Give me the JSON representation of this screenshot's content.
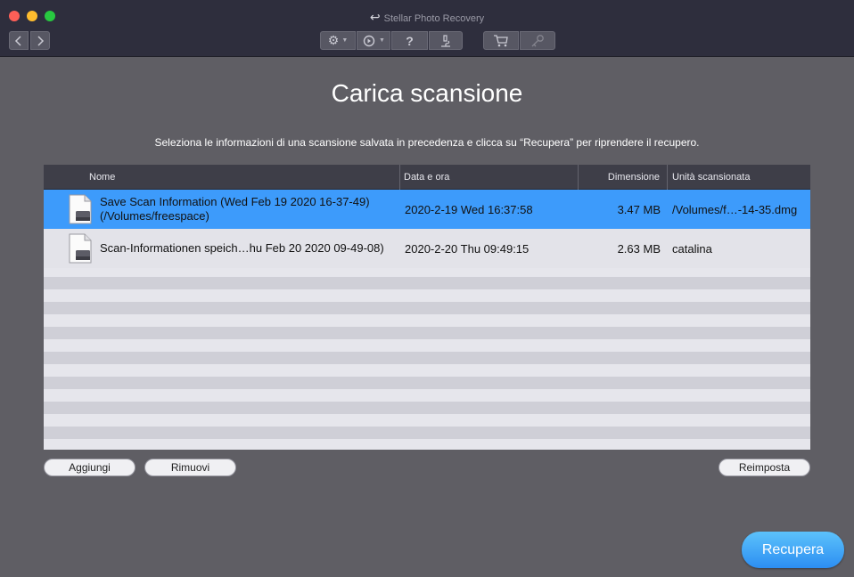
{
  "window": {
    "title": "Stellar Photo Recovery"
  },
  "toolbar": {
    "icons": {
      "back": "chevron-left-icon",
      "forward": "chevron-right-icon",
      "settings": "gear-icon",
      "history": "history-icon",
      "help": "question-icon",
      "scan": "microscope-icon",
      "cart": "cart-icon",
      "key": "key-icon"
    },
    "help_glyph": "?"
  },
  "page": {
    "title": "Carica scansione",
    "subtitle": "Seleziona le informazioni di una scansione salvata in precedenza e clicca su “Recupera” per riprendere il recupero."
  },
  "table": {
    "columns": {
      "name": "Nome",
      "date": "Data e ora",
      "size": "Dimensione",
      "unit": "Unità scansionata"
    },
    "rows": [
      {
        "name_line1": "Save Scan Information (Wed Feb 19 2020 16-37-49)",
        "name_line2": "(/Volumes/freespace)",
        "date": "2020-2-19 Wed 16:37:58",
        "size": "3.47 MB",
        "unit": "/Volumes/f…-14-35.dmg",
        "selected": true
      },
      {
        "name_line1": "Scan-Informationen speich…hu Feb 20 2020 09-49-08)",
        "date": "2020-2-20 Thu 09:49:15",
        "size": "2.63 MB",
        "unit": "catalina",
        "selected": false
      }
    ]
  },
  "buttons": {
    "add": "Aggiungi",
    "remove": "Rimuovi",
    "reset": "Reimposta",
    "recover": "Recupera"
  },
  "colors": {
    "selection": "#3d9bfb",
    "accent": "#2c8ef2"
  }
}
